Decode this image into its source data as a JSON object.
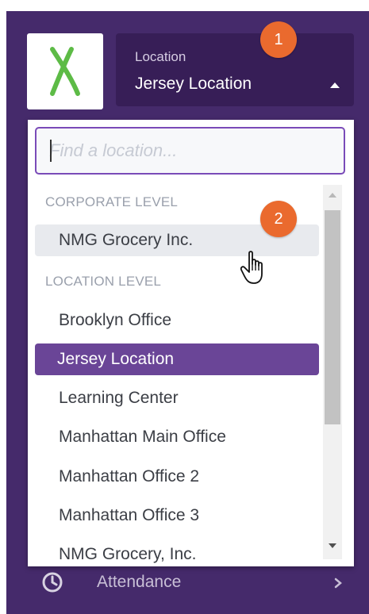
{
  "header": {
    "logo_icon": "company-logo-x-icon",
    "location_label": "Location",
    "location_value": "Jersey Location",
    "caret_icon": "caret-up-icon"
  },
  "annotations": {
    "badge_1": "1",
    "badge_2": "2"
  },
  "dropdown": {
    "search_placeholder": "Find a location...",
    "search_value": "",
    "corporate_header": "CORPORATE LEVEL",
    "corporate_items": [
      "NMG Grocery Inc."
    ],
    "location_header": "LOCATION LEVEL",
    "location_items": [
      "Brooklyn Office",
      "Jersey Location",
      "Learning Center",
      "Manhattan Main Office",
      "Manhattan Office 2",
      "Manhattan Office 3",
      "NMG Grocery, Inc."
    ],
    "selected": "Jersey Location",
    "hovered": "NMG Grocery Inc."
  },
  "nav": {
    "attendance_label": "Attendance",
    "attendance_icon": "clock-icon",
    "chevron_icon": "chevron-right-icon"
  },
  "colors": {
    "sidebar": "#452a6b",
    "location_button": "#371e57",
    "selected_item": "#6a4597",
    "badge": "#ea6a2e",
    "logo_green": "#5dbb46",
    "search_border": "#7a4bb8"
  }
}
